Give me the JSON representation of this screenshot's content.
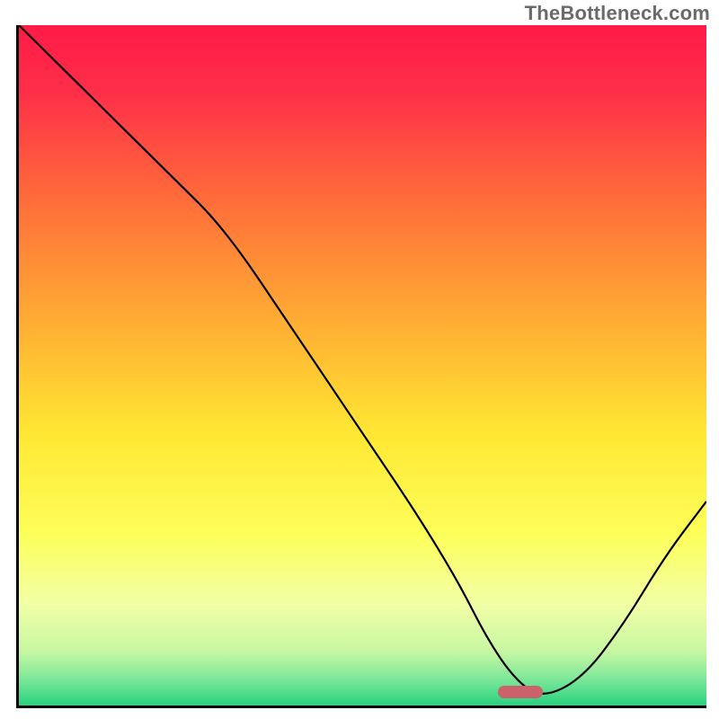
{
  "watermark": "TheBottleneck.com",
  "chart_data": {
    "type": "line",
    "title": "",
    "xlabel": "",
    "ylabel": "",
    "xlim": [
      0,
      100
    ],
    "ylim": [
      0,
      100
    ],
    "grid": false,
    "legend": false,
    "series": [
      {
        "name": "bottleneck-curve",
        "x": [
          0,
          12,
          22,
          30,
          40,
          50,
          58,
          64,
          68,
          72,
          76,
          82,
          88,
          94,
          100
        ],
        "y": [
          100,
          88,
          78,
          70,
          55,
          40,
          28,
          18,
          10,
          4,
          1,
          4,
          12,
          22,
          30
        ]
      }
    ],
    "marker": {
      "x": 73,
      "y": 2,
      "shape": "pill",
      "color": "#cb6169"
    },
    "gradient_stops": [
      {
        "pos": 0,
        "color": "#ff1a47"
      },
      {
        "pos": 10,
        "color": "#ff2f49"
      },
      {
        "pos": 25,
        "color": "#ff6a3a"
      },
      {
        "pos": 45,
        "color": "#ffb233"
      },
      {
        "pos": 60,
        "color": "#ffe733"
      },
      {
        "pos": 75,
        "color": "#fdff5a"
      },
      {
        "pos": 85,
        "color": "#f2ffa6"
      },
      {
        "pos": 92,
        "color": "#c7f7a2"
      },
      {
        "pos": 96,
        "color": "#7fe89a"
      },
      {
        "pos": 100,
        "color": "#27d27e"
      }
    ]
  }
}
